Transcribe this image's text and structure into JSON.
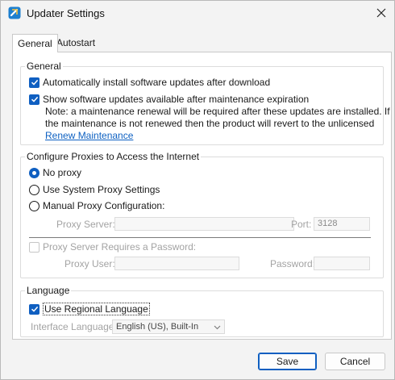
{
  "window": {
    "title": "Updater Settings"
  },
  "tabs": [
    {
      "label": "General",
      "active": true
    },
    {
      "label": "Autostart",
      "active": false
    }
  ],
  "general": {
    "label": "General",
    "auto_install": {
      "label": "Automatically install software updates after download",
      "checked": true
    },
    "show_expired": {
      "label": "Show software updates available after maintenance expiration",
      "checked": true
    },
    "note_line1": "Note: a maintenance renewal will be required after these updates are installed. If",
    "note_line2": "the maintenance is not renewed then the product will revert to the unlicensed",
    "renew_link": "Renew Maintenance"
  },
  "proxy": {
    "label": "Configure Proxies to Access the Internet",
    "options": [
      {
        "label": "No proxy",
        "selected": true
      },
      {
        "label": "Use System Proxy Settings",
        "selected": false
      },
      {
        "label": "Manual Proxy Configuration:",
        "selected": false
      }
    ],
    "server_label": "Proxy Server:",
    "server_value": "",
    "port_label": "Port:",
    "port_value": "3128",
    "password_required": {
      "label": "Proxy Server Requires a Password:",
      "checked": false
    },
    "user_label": "Proxy User:",
    "user_value": "",
    "password_label": "Password:",
    "password_value": ""
  },
  "language": {
    "label": "Language",
    "use_regional": {
      "label": "Use Regional Language",
      "checked": true
    },
    "interface_label": "Interface Language:",
    "interface_value": "English (US), Built-In"
  },
  "buttons": {
    "save": "Save",
    "cancel": "Cancel"
  },
  "colors": {
    "accent": "#0f5fc1",
    "link": "#0e61c2"
  }
}
